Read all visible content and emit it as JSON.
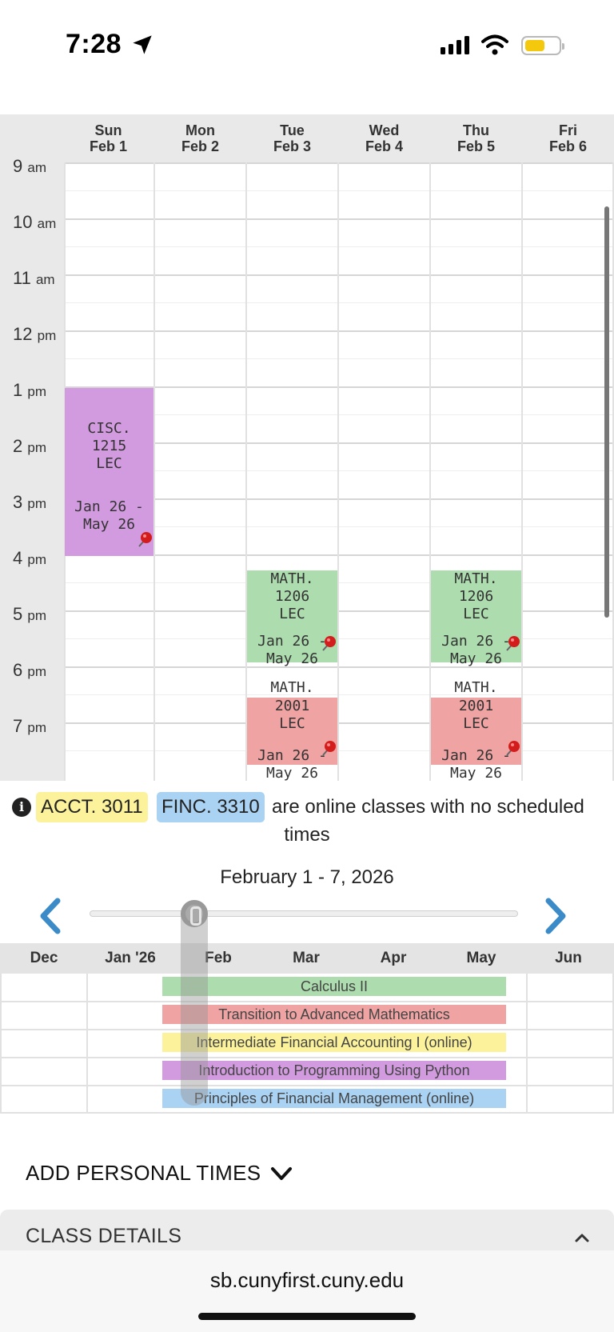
{
  "status_bar": {
    "time": "7:28",
    "battery_color": "#f4c90d"
  },
  "calendar": {
    "days": [
      {
        "name": "Sun",
        "date": "Feb 1"
      },
      {
        "name": "Mon",
        "date": "Feb 2"
      },
      {
        "name": "Tue",
        "date": "Feb 3"
      },
      {
        "name": "Wed",
        "date": "Feb 4"
      },
      {
        "name": "Thu",
        "date": "Feb 5"
      },
      {
        "name": "Fri",
        "date": "Feb 6"
      }
    ],
    "times": [
      {
        "hour": "9",
        "ap": "am"
      },
      {
        "hour": "10",
        "ap": "am"
      },
      {
        "hour": "11",
        "ap": "am"
      },
      {
        "hour": "12",
        "ap": "pm"
      },
      {
        "hour": "1",
        "ap": "pm"
      },
      {
        "hour": "2",
        "ap": "pm"
      },
      {
        "hour": "3",
        "ap": "pm"
      },
      {
        "hour": "4",
        "ap": "pm"
      },
      {
        "hour": "5",
        "ap": "pm"
      },
      {
        "hour": "6",
        "ap": "pm"
      },
      {
        "hour": "7",
        "ap": "pm"
      }
    ],
    "events": [
      {
        "line1": "CISC.",
        "line2": "1215",
        "line3": "LEC",
        "dates1": "Jan 26 -",
        "dates2": "May 26",
        "color": "#d39bdf"
      },
      {
        "line1": "MATH.",
        "line2": "1206",
        "line3": "LEC",
        "dates1": "Jan 26 -",
        "dates2": "May 26",
        "color": "#addcae"
      },
      {
        "line1": "MATH.",
        "line2": "1206",
        "line3": "LEC",
        "dates1": "Jan 26 -",
        "dates2": "May 26",
        "color": "#addcae"
      },
      {
        "line1": "MATH.",
        "line2": "2001",
        "line3": "LEC",
        "dates1": "Jan 26 -",
        "dates2": "May 26",
        "color": "#efa3a2"
      },
      {
        "line1": "MATH.",
        "line2": "2001",
        "line3": "LEC",
        "dates1": "Jan 26 -",
        "dates2": "May 26",
        "color": "#efa3a2"
      }
    ]
  },
  "online_notice": {
    "course1": "ACCT. 3011",
    "course2": "FINC. 3310",
    "text1": "are online classes with no scheduled",
    "text2": "times",
    "course1_color": "#fbf29b",
    "course2_color": "#a9d2f3"
  },
  "range": {
    "label": "February 1 - 7, 2026"
  },
  "timeline": {
    "months": [
      "Dec",
      "Jan '26",
      "Feb",
      "Mar",
      "Apr",
      "May",
      "Jun"
    ],
    "courses": [
      {
        "name": "Calculus II",
        "color": "#addcae"
      },
      {
        "name": "Transition to Advanced Mathematics",
        "color": "#efa3a2"
      },
      {
        "name": "Intermediate Financial Accounting I (online)",
        "color": "#fbf29b"
      },
      {
        "name": "Introduction to Programming Using Python",
        "color": "#d39bdf"
      },
      {
        "name": "Principles of Financial Management (online)",
        "color": "#a9d2f3"
      }
    ]
  },
  "sections": {
    "add_personal_times": "ADD PERSONAL TIMES",
    "class_details": "CLASS DETAILS"
  },
  "browser": {
    "url": "sb.cunyfirst.cuny.edu"
  },
  "accent_color": "#3a8bc7"
}
